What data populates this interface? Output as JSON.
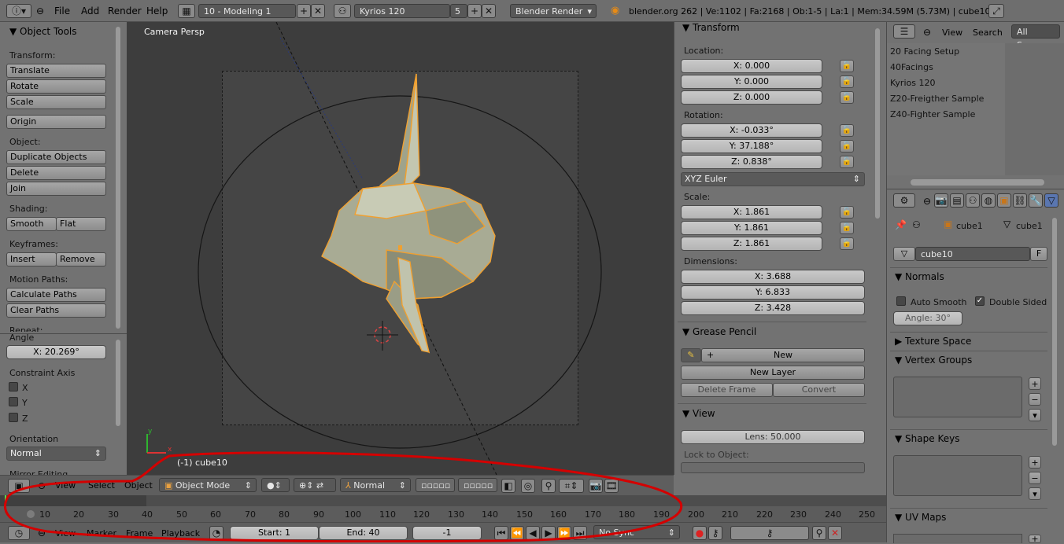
{
  "topbar": {
    "menus": [
      "File",
      "Add",
      "Render",
      "Help"
    ],
    "layout": "10 - Modeling 1",
    "scene": "Kyrios 120",
    "scene_users": "5",
    "engine": "Blender Render",
    "stats": "blender.org 262 | Ve:1102 | Fa:2168 | Ob:1-5 | La:1 | Mem:34.59M (5.73M) | cube10"
  },
  "tools": {
    "title": "Object Tools",
    "transform_label": "Transform:",
    "translate": "Translate",
    "rotate": "Rotate",
    "scale": "Scale",
    "origin": "Origin",
    "object_label": "Object:",
    "duplicate": "Duplicate Objects",
    "delete": "Delete",
    "join": "Join",
    "shading_label": "Shading:",
    "smooth": "Smooth",
    "flat": "Flat",
    "keyframes_label": "Keyframes:",
    "insert": "Insert",
    "remove": "Remove",
    "motion_label": "Motion Paths:",
    "calc_paths": "Calculate Paths",
    "clear_paths": "Clear Paths",
    "repeat_label": "Repeat:"
  },
  "operator": {
    "angle_label": "Angle",
    "angle_value": "X: 20.269°",
    "constraint_label": "Constraint Axis",
    "axes": [
      "X",
      "Y",
      "Z"
    ],
    "orientation_label": "Orientation",
    "orientation_value": "Normal",
    "mirror": "Mirror Editing"
  },
  "viewport": {
    "label": "Camera Persp",
    "object_info": "(-1) cube10"
  },
  "view3d_header": {
    "menus": [
      "View",
      "Select",
      "Object"
    ],
    "mode": "Object Mode",
    "orientation": "Normal"
  },
  "properties": {
    "transform_title": "Transform",
    "location_label": "Location:",
    "location": [
      "X: 0.000",
      "Y: 0.000",
      "Z: 0.000"
    ],
    "rotation_label": "Rotation:",
    "rotation": [
      "X: -0.033°",
      "Y: 37.188°",
      "Z: 0.838°"
    ],
    "rotation_mode": "XYZ Euler",
    "scale_label": "Scale:",
    "scale": [
      "X: 1.861",
      "Y: 1.861",
      "Z: 1.861"
    ],
    "dimensions_label": "Dimensions:",
    "dimensions": [
      "X: 3.688",
      "Y: 6.833",
      "Z: 3.428"
    ],
    "grease_title": "Grease Pencil",
    "grease_new": "New",
    "new_layer": "New Layer",
    "delete_frame": "Delete Frame",
    "convert": "Convert",
    "view_title": "View",
    "lens": "Lens: 50.000",
    "lock_label": "Lock to Object:"
  },
  "outliner": {
    "menus": [
      "View",
      "Search"
    ],
    "filter": "All Scenes",
    "items": [
      "20 Facing Setup",
      "40Facings",
      "Kyrios 120",
      "Z20-Freigther Sample",
      "Z40-Fighter Sample"
    ]
  },
  "data_panel": {
    "breadcrumb_obj": "cube1",
    "breadcrumb_mesh": "cube1",
    "mesh_name": "cube10",
    "fake_user": "F",
    "normals_title": "Normals",
    "auto_smooth": "Auto Smooth",
    "double_sided": "Double Sided",
    "angle": "Angle: 30°",
    "texture_space": "Texture Space",
    "vertex_groups": "Vertex Groups",
    "shape_keys": "Shape Keys",
    "uv_maps": "UV Maps"
  },
  "timeline": {
    "ticks": [
      "10",
      "20",
      "30",
      "40",
      "50",
      "60",
      "70",
      "80",
      "90",
      "100",
      "110",
      "120",
      "130",
      "140",
      "150",
      "160",
      "170",
      "180",
      "190",
      "200",
      "210",
      "220",
      "230",
      "240",
      "250"
    ],
    "menus": [
      "View",
      "Marker",
      "Frame",
      "Playback"
    ],
    "start": "Start: 1",
    "end": "End: 40",
    "current": "-1",
    "sync": "No Sync"
  },
  "colors": {
    "annotation": "#d40000",
    "selection": "#f0a030",
    "mesh": "#a8ab94"
  }
}
